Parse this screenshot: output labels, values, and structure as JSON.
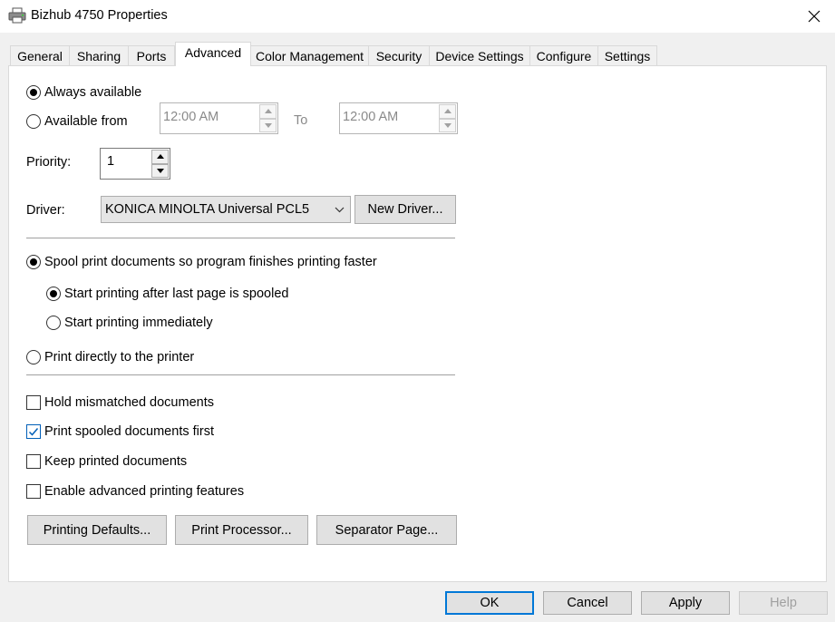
{
  "window": {
    "title": "Bizhub 4750 Properties",
    "icon": "printer-icon",
    "close_icon": "close-icon"
  },
  "tabs": [
    {
      "label": "General",
      "active": false
    },
    {
      "label": "Sharing",
      "active": false
    },
    {
      "label": "Ports",
      "active": false
    },
    {
      "label": "Advanced",
      "active": true
    },
    {
      "label": "Color Management",
      "active": false
    },
    {
      "label": "Security",
      "active": false
    },
    {
      "label": "Device Settings",
      "active": false
    },
    {
      "label": "Configure",
      "active": false
    },
    {
      "label": "Settings",
      "active": false
    }
  ],
  "availability": {
    "always_label": "Always available",
    "always_selected": true,
    "from_label": "Available from",
    "from_selected": false,
    "from_time": "12:00 AM",
    "to_label": "To",
    "to_time": "12:00 AM"
  },
  "priority": {
    "label": "Priority:",
    "value": "1"
  },
  "driver": {
    "label": "Driver:",
    "selected": "KONICA MINOLTA Universal PCL5",
    "new_driver_button": "New Driver..."
  },
  "spooling": {
    "spool_label": "Spool print documents so program finishes printing faster",
    "spool_selected": true,
    "after_last_label": "Start printing after last page is spooled",
    "after_last_selected": true,
    "immediately_label": "Start printing immediately",
    "immediately_selected": false,
    "direct_label": "Print directly to the printer",
    "direct_selected": false
  },
  "options": {
    "hold_mismatched": {
      "label": "Hold mismatched documents",
      "checked": false
    },
    "spooled_first": {
      "label": "Print spooled documents first",
      "checked": true
    },
    "keep_printed": {
      "label": "Keep printed documents",
      "checked": false
    },
    "advanced_features": {
      "label": "Enable advanced printing features",
      "checked": false
    }
  },
  "panel_buttons": {
    "printing_defaults": "Printing Defaults...",
    "print_processor": "Print Processor...",
    "separator_page": "Separator Page..."
  },
  "dialog_buttons": {
    "ok": "OK",
    "cancel": "Cancel",
    "apply": "Apply",
    "help": "Help"
  },
  "colors": {
    "accent": "#0078d7",
    "checkbox_tick": "#005fb8",
    "window_bg": "#f0f0f0"
  }
}
